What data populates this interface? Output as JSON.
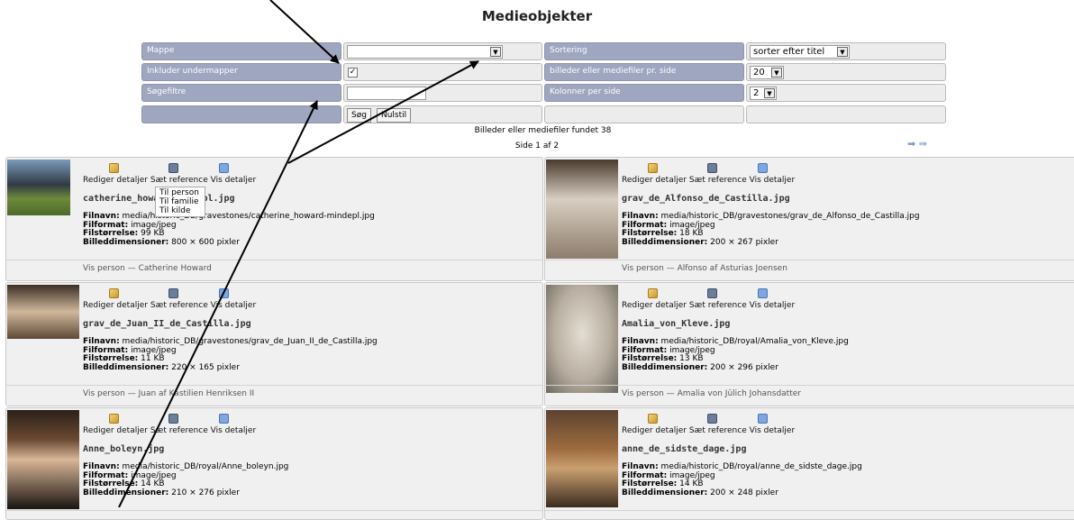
{
  "title": "Medieobjekter",
  "filters": {
    "mappe_label": "Mappe",
    "mappe_value": "",
    "inkluder_label": "Inkluder undermapper",
    "inkluder_checked": "✓",
    "sogefiltre_label": "Søgefiltre",
    "sortering_label": "Sortering",
    "sortering_value": "sorter efter titel",
    "pr_side_label": "billeder eller mediefiler pr. side",
    "pr_side_value": "20",
    "kolonner_label": "Kolonner per side",
    "kolonner_value": "2",
    "search_button": "Søg",
    "reset_button": "Nulstil"
  },
  "found_text": "Billeder eller mediefiler fundet 38",
  "page_text": "Side 1 af 2",
  "nav_arrows": "➡ ⇛",
  "actions": {
    "edit": "Rediger detaljer",
    "ref": "Sæt reference",
    "details": "Vis detaljer"
  },
  "labels": {
    "filename": "Filnavn:",
    "format": "Filformat:",
    "size": "Filstørrelse:",
    "dims": "Billeddimensioner:"
  },
  "popup": [
    "Til person",
    "Til familie",
    "Til kilde"
  ],
  "cards": [
    {
      "title": "catherine_howard-mindepl.jpg",
      "filename": "media/historic_DB/gravestones/catherine_howard-mindepl.jpg",
      "format": "image/jpeg",
      "size": "99 KB",
      "dims": "800 × 600 pixler",
      "person": "Vis person — Catherine Howard"
    },
    {
      "title": "grav_de_Alfonso_de_Castilla.jpg",
      "filename": "media/historic_DB/gravestones/grav_de_Alfonso_de_Castilla.jpg",
      "format": "image/jpeg",
      "size": "18 KB",
      "dims": "200 × 267 pixler",
      "person": "Vis person — Alfonso af Asturias Joensen"
    },
    {
      "title": "grav_de_Juan_II_de_Castilla.jpg",
      "filename": "media/historic_DB/gravestones/grav_de_Juan_II_de_Castilla.jpg",
      "format": "image/jpeg",
      "size": "11 KB",
      "dims": "220 × 165 pixler",
      "person": "Vis person — Juan af Kastilien Henriksen II"
    },
    {
      "title": "Amalia_von_Kleve.jpg",
      "filename": "media/historic_DB/royal/Amalia_von_Kleve.jpg",
      "format": "image/jpeg",
      "size": "13 KB",
      "dims": "200 × 296 pixler",
      "person": "Vis person — Amalia von Jülich Johansdatter"
    },
    {
      "title": "Anne_boleyn.jpg",
      "filename": "media/historic_DB/royal/Anne_boleyn.jpg",
      "format": "image/jpeg",
      "size": "14 KB",
      "dims": "210 × 276 pixler",
      "person": ""
    },
    {
      "title": "anne_de_sidste_dage.jpg",
      "filename": "media/historic_DB/royal/anne_de_sidste_dage.jpg",
      "format": "image/jpeg",
      "size": "14 KB",
      "dims": "200 × 248 pixler",
      "person": ""
    }
  ]
}
